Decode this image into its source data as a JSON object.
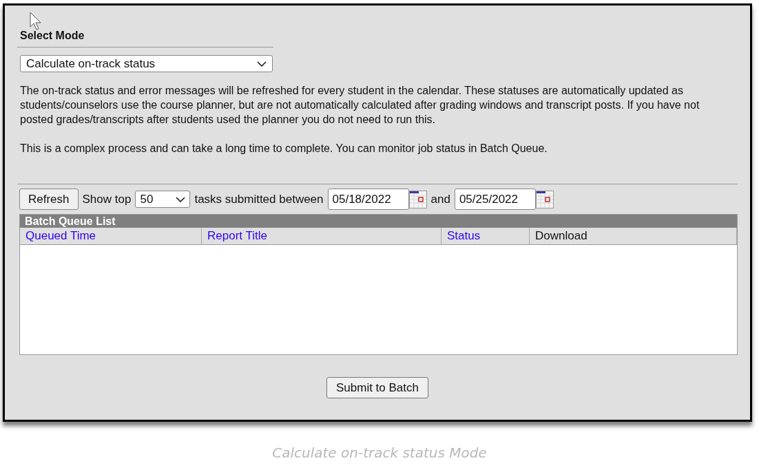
{
  "mode_section": {
    "heading": "Select Mode",
    "select_value": "Calculate on-track status"
  },
  "description": [
    "The on-track status and error messages will be refreshed for every student in the calendar. These statuses are automatically updated as students/counselors use the course planner, but are not automatically calculated after grading windows and transcript posts. If you have not posted grades/transcripts after students used the planner you do not need to run this.",
    "This is a complex process and can take a long time to complete. You can monitor job status in Batch Queue."
  ],
  "toolbar": {
    "refresh_button": "Refresh",
    "show_top_label": "Show top",
    "show_top_value": "50",
    "between_label": "tasks submitted between",
    "start_date": "05/18/2022",
    "and_label": "and",
    "end_date": "05/25/2022"
  },
  "batch_queue": {
    "title": "Batch Queue List",
    "columns": [
      {
        "label": "Queued Time",
        "kind": "link"
      },
      {
        "label": "Report Title",
        "kind": "link"
      },
      {
        "label": "Status",
        "kind": "link"
      },
      {
        "label": "Download",
        "kind": "plain"
      }
    ]
  },
  "submit_button": "Submit to Batch",
  "caption": "Calculate on-track status Mode"
}
